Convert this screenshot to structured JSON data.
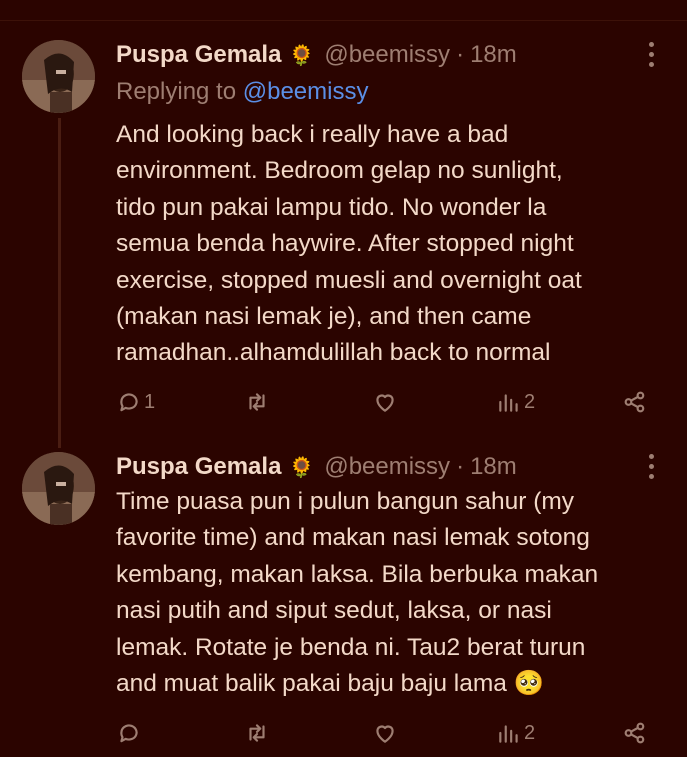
{
  "tweets": [
    {
      "name": "Puspa Gemala",
      "badge": "🌻",
      "handle": "@beemissy",
      "separator": "·",
      "time": "18m",
      "reply_label": "Replying to",
      "reply_mention": "@beemissy",
      "lines": [
        "And looking back i really have a bad",
        "environment. Bedroom gelap no sunlight,",
        "tido pun pakai lampu tido. No wonder la",
        "semua benda haywire. After stopped night",
        "exercise, stopped muesli and overnight oat",
        "(makan nasi lemak je), and then came",
        "ramadhan..alhamdulillah back to normal"
      ],
      "reply_count": "1",
      "retweet_count": "",
      "like_count": "",
      "view_count": "2"
    },
    {
      "name": "Puspa Gemala",
      "badge": "🌻",
      "handle": "@beemissy",
      "separator": "·",
      "time": "18m",
      "lines": [
        "Time puasa pun i pulun bangun sahur (my",
        "favorite time) and makan nasi lemak sotong",
        "kembang, makan laksa. Bila berbuka makan",
        "nasi putih and siput sedut, laksa, or nasi",
        "lemak. Rotate je benda ni. Tau2 berat turun",
        "and muat balik pakai baju baju lama 🥺"
      ],
      "reply_count": "",
      "retweet_count": "",
      "like_count": "",
      "view_count": "2"
    }
  ],
  "colors": {
    "background": "#2b0400",
    "text": "#f3d9c8",
    "muted": "#9e7e72",
    "link": "#5b8fe6"
  }
}
